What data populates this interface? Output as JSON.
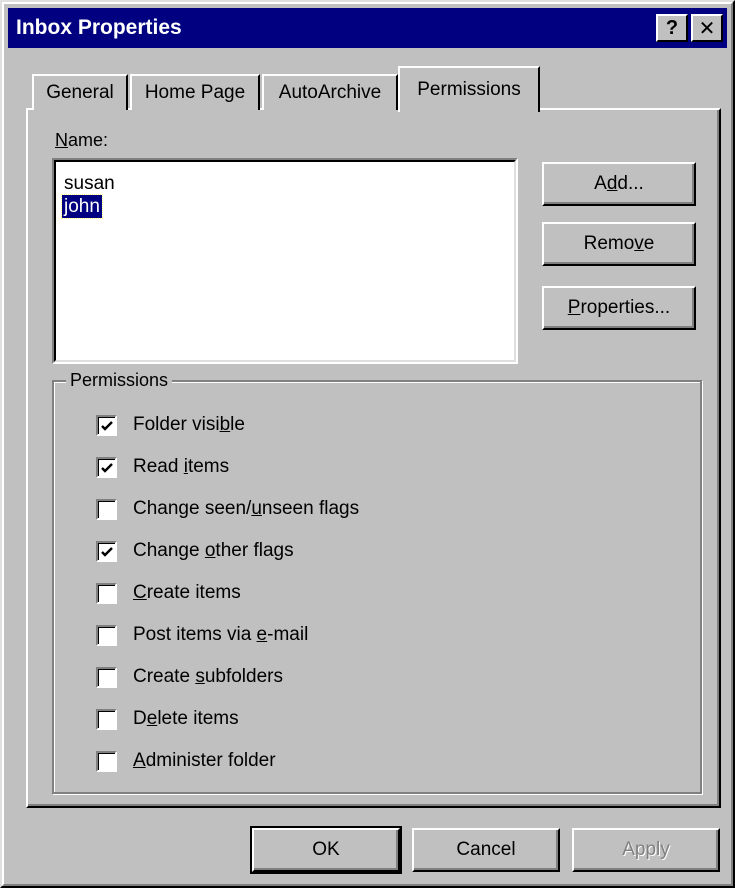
{
  "window": {
    "title": "Inbox Properties",
    "help_glyph": "?",
    "close_glyph": "✕"
  },
  "tabs": [
    {
      "label": "General",
      "active": false
    },
    {
      "label": "Home Page",
      "active": false
    },
    {
      "label": "AutoArchive",
      "active": false
    },
    {
      "label": "Permissions",
      "active": true
    }
  ],
  "name_section": {
    "label": "Name:",
    "users": [
      {
        "name": "susan",
        "selected": false
      },
      {
        "name": "john",
        "selected": true
      }
    ]
  },
  "side_buttons": {
    "add": "Add...",
    "remove": "Remove",
    "properties": "Properties..."
  },
  "permissions": {
    "group_label": "Permissions",
    "items": [
      {
        "label": "Folder visible",
        "checked": true
      },
      {
        "label": "Read items",
        "checked": true
      },
      {
        "label": "Change seen/unseen flags",
        "checked": false
      },
      {
        "label": "Change other flags",
        "checked": true
      },
      {
        "label": "Create items",
        "checked": false
      },
      {
        "label": "Post items via e-mail",
        "checked": false
      },
      {
        "label": "Create subfolders",
        "checked": false
      },
      {
        "label": "Delete items",
        "checked": false
      },
      {
        "label": "Administer folder",
        "checked": false
      }
    ]
  },
  "footer_buttons": {
    "ok": "OK",
    "cancel": "Cancel",
    "apply": "Apply"
  },
  "colors": {
    "titlebar": "#000080",
    "face": "#c0c0c0",
    "selection": "#000080"
  }
}
